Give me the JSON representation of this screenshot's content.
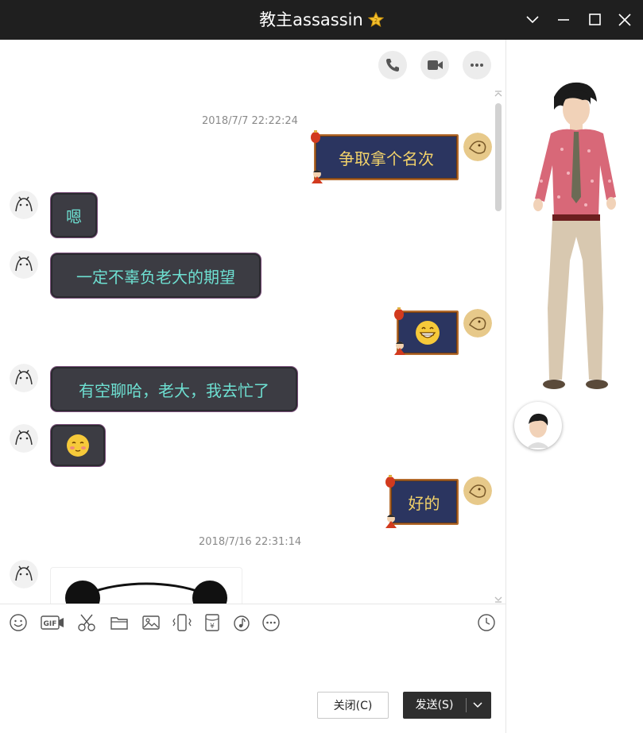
{
  "window": {
    "title": "教主assassin",
    "controls": [
      "chevron-down-icon",
      "minimize-icon",
      "maximize-icon",
      "close-icon"
    ]
  },
  "chat_actions": [
    "phone-icon",
    "video-icon",
    "more-icon"
  ],
  "messages": [
    {
      "type": "timestamp",
      "text": "2018/7/7 22:22:24"
    },
    {
      "type": "out",
      "text": "争取拿个名次"
    },
    {
      "type": "in",
      "text": "嗯"
    },
    {
      "type": "in",
      "text": "一定不辜负老大的期望"
    },
    {
      "type": "out",
      "emoji": "grin-emoji"
    },
    {
      "type": "in",
      "text": "有空聊哈，老大，我去忙了"
    },
    {
      "type": "in",
      "emoji": "shy-emoji"
    },
    {
      "type": "out",
      "text": "好的"
    },
    {
      "type": "timestamp",
      "text": "2018/7/16 22:31:14"
    },
    {
      "type": "in",
      "image": "panda-sticker"
    }
  ],
  "toolbar": [
    "emoji-icon",
    "gif-icon",
    "scissors-icon",
    "folder-icon",
    "image-icon",
    "shake-icon",
    "red-packet-icon",
    "music-icon",
    "more-icon",
    "history-clock-icon"
  ],
  "buttons": {
    "close_label": "关闭(C)",
    "send_label": "发送(S)"
  },
  "colors": {
    "titlebar": "#1f1f1f",
    "out_bubble_bg": "#2b3560",
    "out_bubble_text": "#f3d36a",
    "in_bubble_bg": "#3c3c43",
    "in_bubble_text": "#6ee0d2"
  }
}
